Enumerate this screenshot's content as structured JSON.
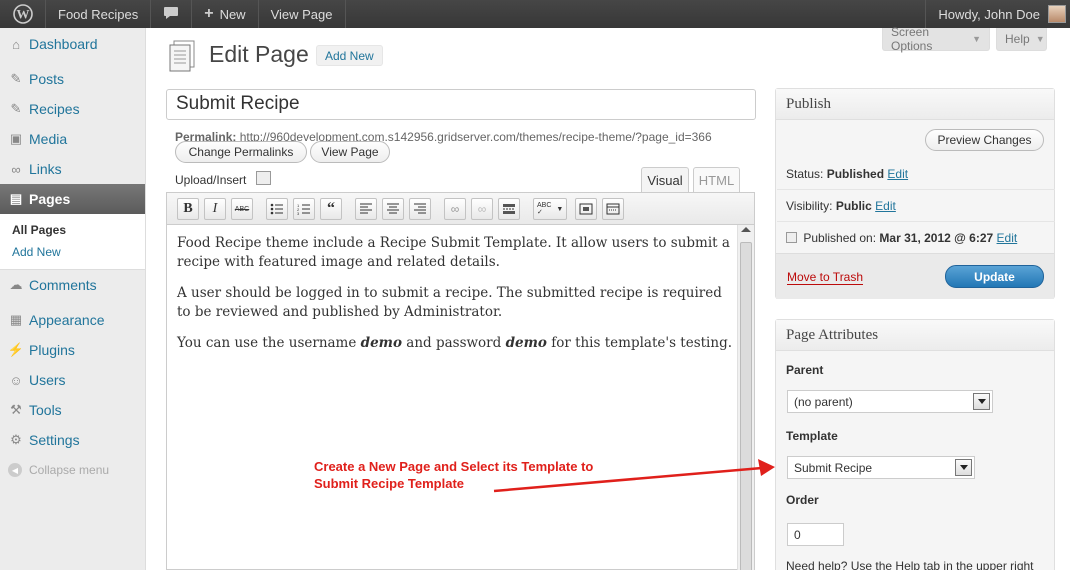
{
  "adminbar": {
    "site_name": "Food Recipes",
    "new_label": "New",
    "view_page": "View Page",
    "howdy": "Howdy, John Doe"
  },
  "sidebar": {
    "items": [
      {
        "label": "Dashboard",
        "icon": "dashboard-icon"
      },
      {
        "label": "Posts",
        "icon": "pin-icon"
      },
      {
        "label": "Recipes",
        "icon": "pin-icon"
      },
      {
        "label": "Media",
        "icon": "media-icon"
      },
      {
        "label": "Links",
        "icon": "link-icon"
      },
      {
        "label": "Pages",
        "icon": "pages-icon"
      },
      {
        "label": "Comments",
        "icon": "comment-icon"
      },
      {
        "label": "Appearance",
        "icon": "appearance-icon"
      },
      {
        "label": "Plugins",
        "icon": "plugin-icon"
      },
      {
        "label": "Users",
        "icon": "users-icon"
      },
      {
        "label": "Tools",
        "icon": "tools-icon"
      },
      {
        "label": "Settings",
        "icon": "settings-icon"
      }
    ],
    "submenu": [
      "All Pages",
      "Add New"
    ],
    "collapse": "Collapse menu"
  },
  "screen_options": "Screen Options",
  "help": "Help",
  "header": {
    "title": "Edit Page",
    "add_new": "Add New"
  },
  "post": {
    "title": "Submit Recipe",
    "permalink_label": "Permalink:",
    "permalink_url": "http://960development.com.s142956.gridserver.com/themes/recipe-theme/?page_id=366",
    "change_permalinks": "Change Permalinks",
    "view_page": "View Page",
    "upload_insert": "Upload/Insert",
    "tab_visual": "Visual",
    "tab_html": "HTML",
    "content": {
      "p1": "Food Recipe theme include a Recipe Submit Template. It allow users to submit a recipe with featured image and related details.",
      "p2": "A user should be logged in to submit a recipe. The submitted recipe is required to be reviewed and published by Administrator.",
      "p3_a": "You can use the username ",
      "p3_b": "demo",
      "p3_c": " and password ",
      "p3_d": "demo",
      "p3_e": " for this template's testing."
    }
  },
  "publish": {
    "title": "Publish",
    "preview": "Preview Changes",
    "status_label": "Status:",
    "status_value": "Published",
    "visibility_label": "Visibility:",
    "visibility_value": "Public",
    "published_label": "Published on:",
    "published_value": "Mar 31, 2012 @ 6:27",
    "edit": "Edit",
    "trash": "Move to Trash",
    "update": "Update"
  },
  "attributes": {
    "title": "Page Attributes",
    "parent_label": "Parent",
    "parent_value": "(no parent)",
    "template_label": "Template",
    "template_value": "Submit Recipe",
    "order_label": "Order",
    "order_value": "0",
    "help_text": "Need help? Use the Help tab in the upper right"
  },
  "annotation": {
    "line1": "Create a New Page and Select its Template to",
    "line2": "Submit Recipe Template",
    "color": "#e0201b"
  },
  "colors": {
    "link": "#21759b",
    "update_button": "#2e8ac8"
  }
}
